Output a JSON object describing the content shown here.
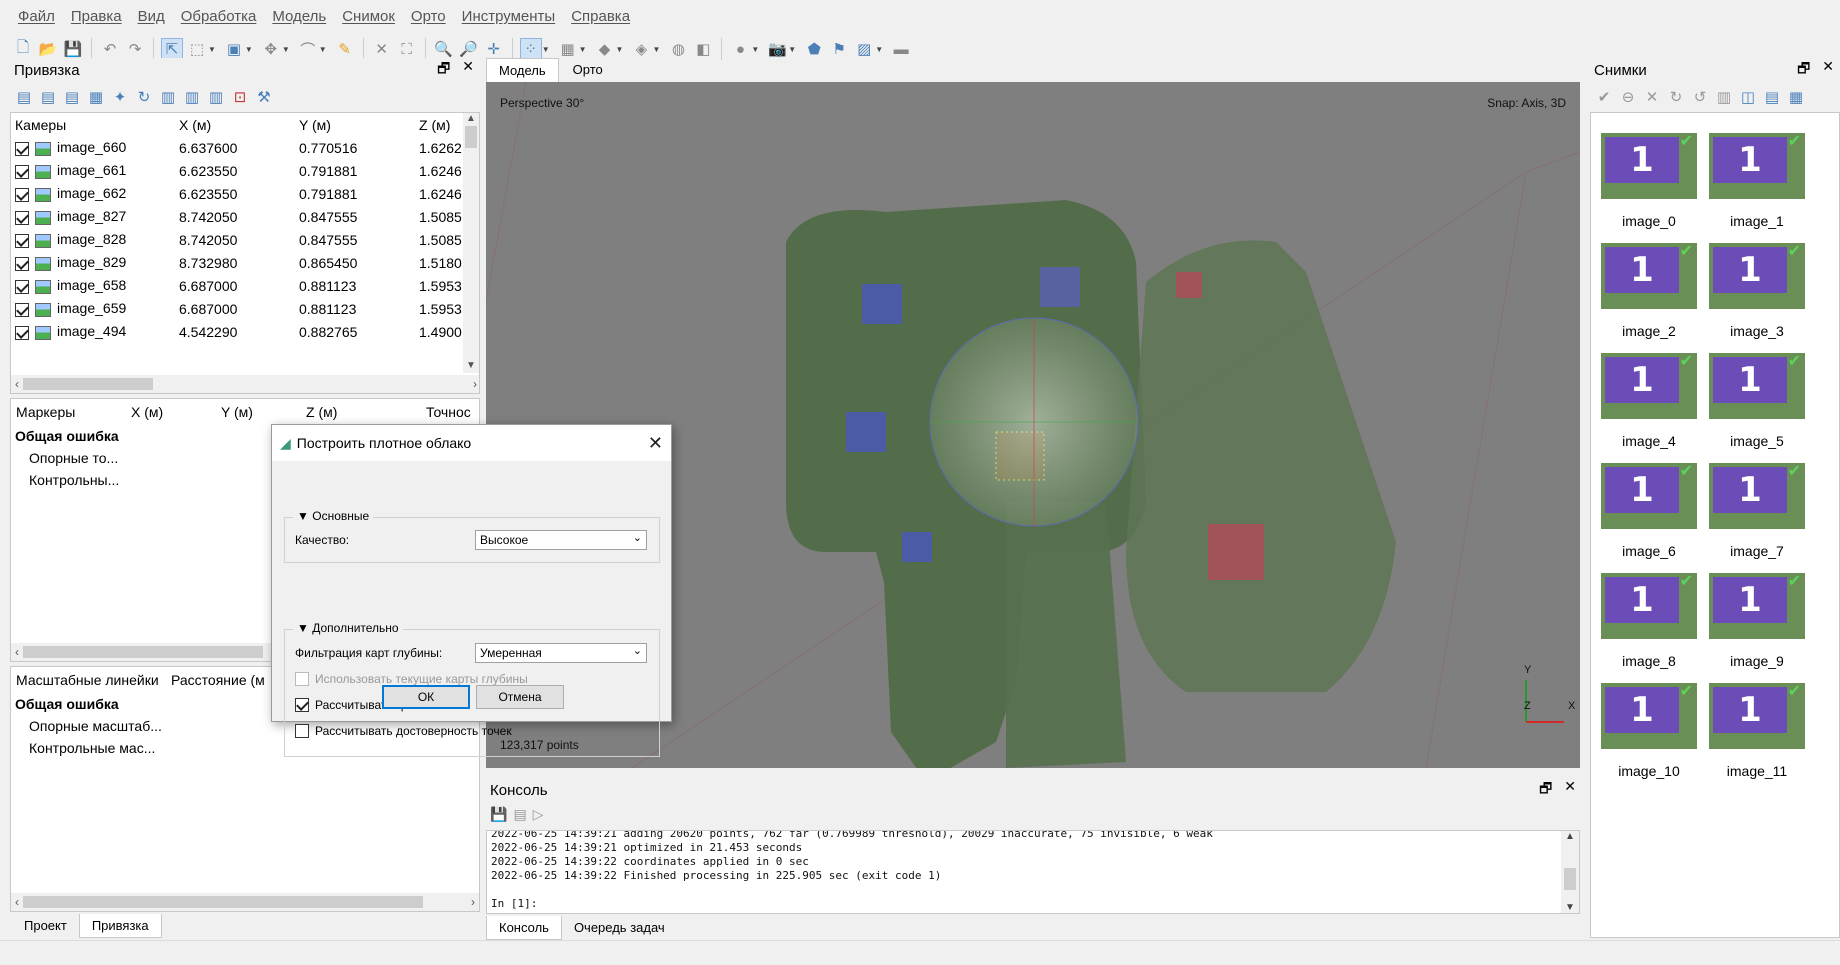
{
  "menu": [
    "Файл",
    "Правка",
    "Вид",
    "Обработка",
    "Модель",
    "Снимок",
    "Орто",
    "Инструменты",
    "Справка"
  ],
  "left_panel": {
    "title": "Привязка",
    "cameras": {
      "headers": [
        "Камеры",
        "X (м)",
        "Y (м)",
        "Z (м)"
      ],
      "rows": [
        {
          "name": "image_660",
          "x": "6.637600",
          "y": "0.770516",
          "z": "1.6262"
        },
        {
          "name": "image_661",
          "x": "6.623550",
          "y": "0.791881",
          "z": "1.6246"
        },
        {
          "name": "image_662",
          "x": "6.623550",
          "y": "0.791881",
          "z": "1.6246"
        },
        {
          "name": "image_827",
          "x": "8.742050",
          "y": "0.847555",
          "z": "1.5085"
        },
        {
          "name": "image_828",
          "x": "8.742050",
          "y": "0.847555",
          "z": "1.5085"
        },
        {
          "name": "image_829",
          "x": "8.732980",
          "y": "0.865450",
          "z": "1.5180"
        },
        {
          "name": "image_658",
          "x": "6.687000",
          "y": "0.881123",
          "z": "1.5953"
        },
        {
          "name": "image_659",
          "x": "6.687000",
          "y": "0.881123",
          "z": "1.5953"
        },
        {
          "name": "image_494",
          "x": "4.542290",
          "y": "0.882765",
          "z": "1.4900"
        }
      ]
    },
    "markers": {
      "headers": [
        "Маркеры",
        "X (м)",
        "Y (м)",
        "Z (м)",
        "Точнос"
      ],
      "total": "Общая ошибка",
      "items": [
        "Опорные то...",
        "Контрольны..."
      ]
    },
    "scalebars": {
      "headers": [
        "Масштабные линейки",
        "Расстояние (м"
      ],
      "total": "Общая ошибка",
      "items": [
        "Опорные масштаб...",
        "Контрольные мас..."
      ]
    },
    "tabs": [
      "Проект",
      "Привязка"
    ]
  },
  "viewport": {
    "tabs": [
      "Модель",
      "Орто"
    ],
    "projection": "Perspective 30°",
    "snap": "Snap: Axis, 3D",
    "points": "123,317 points",
    "axis": {
      "y": "Y",
      "z": "Z",
      "x": "X"
    }
  },
  "dialog": {
    "title": "Построить плотное облако",
    "group_main": "Основные",
    "quality_label": "Качество:",
    "quality_value": "Высокое",
    "group_extra": "Дополнительно",
    "filter_label": "Фильтрация карт глубины:",
    "filter_value": "Умеренная",
    "use_current": "Использовать текущие карты глубины",
    "calc_colors": "Рассчитывать цвета точек",
    "calc_confidence": "Рассчитывать достоверность точек",
    "ok": "ОК",
    "cancel": "Отмена"
  },
  "console": {
    "title": "Консоль",
    "lines": [
      "2022-06-25 14:39:21 adding 20620 points, 762 far (0.769989 threshold), 20029 inaccurate, 75 invisible, 6 weak",
      "2022-06-25 14:39:21 optimized in 21.453 seconds",
      "2022-06-25 14:39:22 coordinates applied in 0 sec",
      "2022-06-25 14:39:22 Finished processing in 225.905 sec (exit code 1)"
    ],
    "prompt": "In [1]:",
    "tabs": [
      "Консоль",
      "Очередь задач"
    ]
  },
  "photos": {
    "title": "Снимки",
    "items": [
      "image_0",
      "image_1",
      "image_2",
      "image_3",
      "image_4",
      "image_5",
      "image_6",
      "image_7",
      "image_8",
      "image_9",
      "image_10",
      "image_11"
    ]
  }
}
